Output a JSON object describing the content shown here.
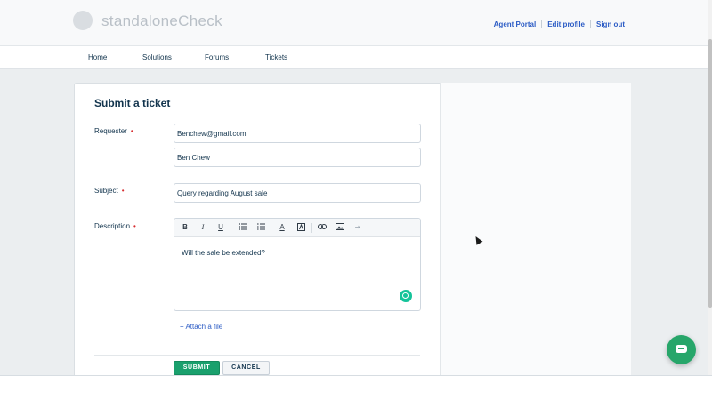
{
  "header": {
    "logo_text": "standaloneCheck",
    "links": [
      "Agent Portal",
      "Edit profile",
      "Sign out"
    ]
  },
  "nav": {
    "items": [
      "Home",
      "Solutions",
      "Forums",
      "Tickets"
    ]
  },
  "form": {
    "title": "Submit a ticket",
    "requester_label": "Requester",
    "requester_email": "Benchew@gmail.com",
    "requester_name": "Ben Chew",
    "subject_label": "Subject",
    "subject_value": "Query regarding August sale",
    "description_label": "Description",
    "required_mark": "•",
    "description_text": "Will the sale be extended?",
    "toolbar": {
      "bold": "B",
      "italic": "I",
      "underline": "U",
      "font_color": "A",
      "clear_format": "⇥"
    },
    "attach_label": "+ Attach a file",
    "submit_label": "SUBMIT",
    "cancel_label": "CANCEL"
  },
  "colors": {
    "accent": "#2c5cc5",
    "submit": "#1aa06d",
    "chat": "#27a66a",
    "required": "#d72d30"
  }
}
